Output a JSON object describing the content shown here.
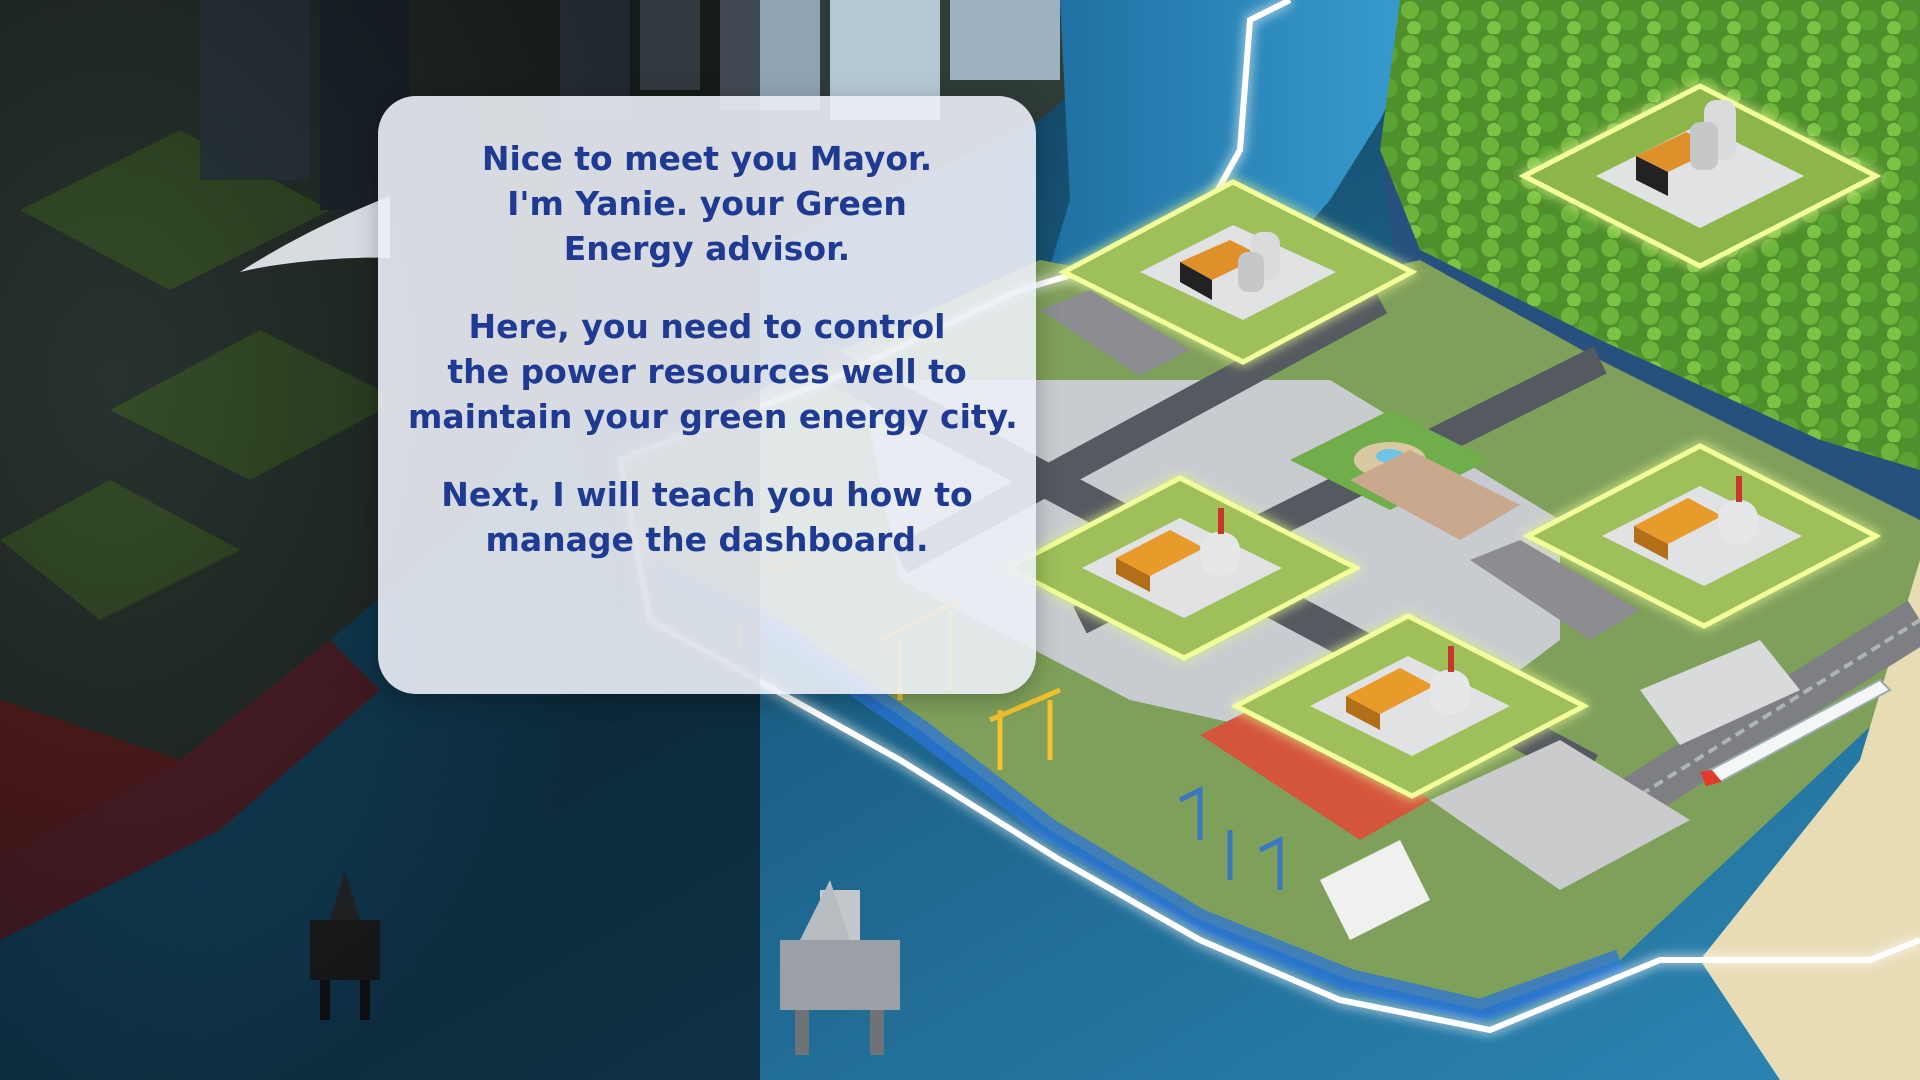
{
  "dialog": {
    "speaker": "Yanie",
    "paragraphs": [
      [
        "Nice to meet you Mayor.",
        "I'm Yanie. your Green",
        "Energy advisor."
      ],
      [
        "Here, you need to control",
        "the power resources well to",
        "maintain your green energy city."
      ],
      [
        "Next, I will teach you how to",
        "manage the dashboard."
      ]
    ]
  },
  "colors": {
    "dialog_text": "#1f3a93",
    "bubble_bg": "#eceff6",
    "ocean": "#1b5f86",
    "zone_glow": "#f2ff9a",
    "boundary_glow": "#ffffff"
  },
  "map": {
    "highlighted_power_plant_zones": 5,
    "icons": [
      "power-plant-icon",
      "oil-rig-icon",
      "port-crane-icon",
      "train-icon",
      "fountain-plaza-icon"
    ]
  }
}
